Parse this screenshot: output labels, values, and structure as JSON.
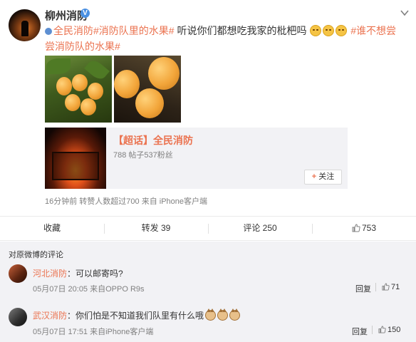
{
  "post": {
    "username": "柳州消防",
    "verified_badge": "V",
    "text_segments": [
      {
        "type": "tag",
        "text": "全民消防"
      },
      {
        "type": "tag",
        "text": "#消防队里的水果#"
      },
      {
        "type": "plain",
        "text": " 听说你们都想吃我家的枇杷吗"
      },
      {
        "type": "tag",
        "text": "#谁不想尝尝消防队的水果#"
      }
    ],
    "icons": {
      "location": "location-icon",
      "emoji": "smug-emoji",
      "more": "chevron-down-icon"
    },
    "topic_card": {
      "title": "【超话】全民消防",
      "stats": "788 帖子537粉丝",
      "follow_label": "关注"
    },
    "meta": "16分钟前 转赞人数超过700 来自 iPhone客户端"
  },
  "actions": {
    "favorite": "收藏",
    "repost": "转发 39",
    "comment": "评论 250",
    "like": "753"
  },
  "comments": {
    "header": "对原微博的评论",
    "items": [
      {
        "name": "河北消防",
        "text": "：可以邮寄吗?",
        "meta": "05月07日 20:05 来自OPPO R9s",
        "reply": "回复",
        "likes": "71"
      },
      {
        "name": "武汉消防",
        "text": "：你们怕是不知道我们队里有什么哦",
        "meta": "05月07日 17:51 来自iPhone客户端",
        "reply": "回复",
        "likes": "150"
      }
    ]
  },
  "colors": {
    "accent": "#eb7350",
    "link": "#eb7350",
    "muted": "#808080",
    "comment_bg": "#f2f2f5"
  }
}
